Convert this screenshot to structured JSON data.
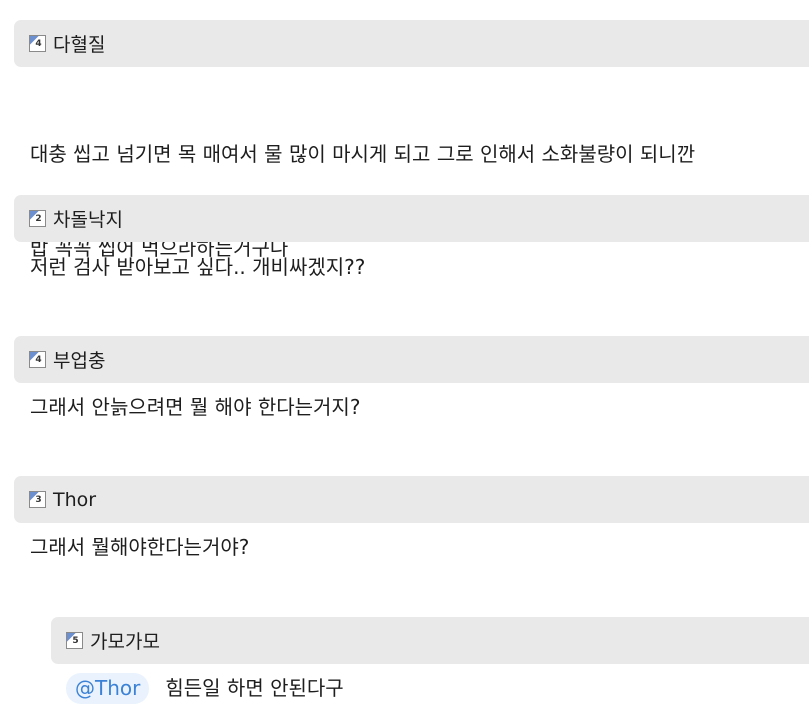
{
  "comments": [
    {
      "level": "4",
      "nickname": "다혈질",
      "body_line1": "대충 씹고 넘기면 목 매여서 물 많이 마시게 되고 그로 인해서 소화불량이 되니깐",
      "body_line2": "밥 꼭꼭 씹어 먹으라하는거구나"
    },
    {
      "level": "2",
      "nickname": "차돌낙지",
      "body": "저런 검사 받아보고 싶다.. 개비싸겠지??"
    },
    {
      "level": "4",
      "nickname": "부업충",
      "body": "그래서 안늙으려면 뭘 해야 한다는거지?"
    },
    {
      "level": "3",
      "nickname": "Thor",
      "body": "그래서 뭘해야한다는거야?"
    }
  ],
  "reply": {
    "level": "5",
    "nickname": "가모가모",
    "mention": "@Thor",
    "body": "힘든일 하면 안된다구"
  }
}
